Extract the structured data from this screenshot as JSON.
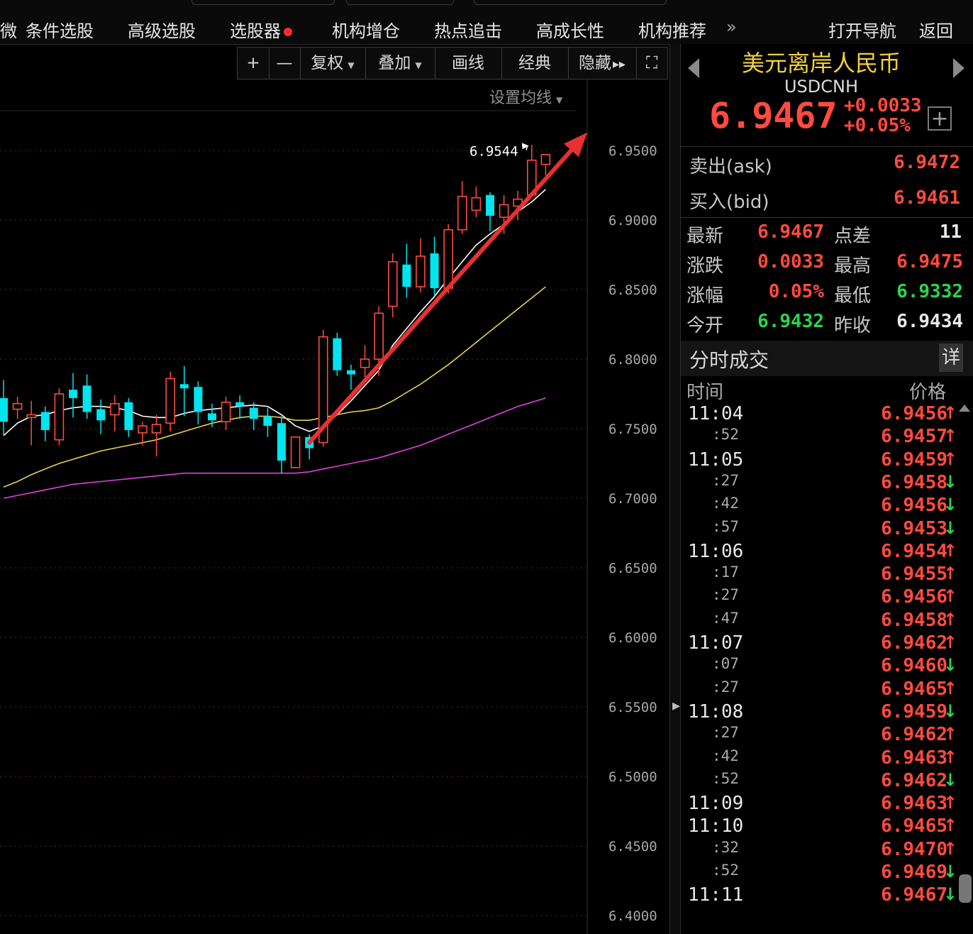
{
  "nav": {
    "partial_left": "微",
    "items": [
      "条件选股",
      "高级选股",
      "选股器",
      "机构增仓",
      "热点追击",
      "高成长性",
      "机构推荐"
    ],
    "more": "»",
    "open_nav": "打开导航",
    "back": "返回"
  },
  "toolbar": {
    "plus": "+",
    "minus": "—",
    "fuquan": "复权",
    "overlay": "叠加",
    "draw": "画线",
    "classic": "经典",
    "hide": "隐藏",
    "hide_arrow": "▸▸",
    "fullscreen": "⛶"
  },
  "chart": {
    "set_ma": "设置均线",
    "high_label": "6.9544",
    "y_ticks": [
      "6.9500",
      "6.9000",
      "6.8500",
      "6.8000",
      "6.7500",
      "6.7000",
      "6.6500",
      "6.6000",
      "6.5500",
      "6.5000",
      "6.4500",
      "6.4000"
    ]
  },
  "chart_data": {
    "type": "candlestick",
    "y_axis": {
      "min": 6.4,
      "max": 6.95,
      "ticks": [
        6.95,
        6.9,
        6.85,
        6.8,
        6.75,
        6.7,
        6.65,
        6.6,
        6.55,
        6.5,
        6.45,
        6.4
      ]
    },
    "annotation": {
      "text": "6.9544",
      "value": 6.9544
    },
    "candles": [
      {
        "o": 6.772,
        "c": 6.755,
        "h": 6.785,
        "l": 6.745
      },
      {
        "o": 6.764,
        "c": 6.768,
        "h": 6.773,
        "l": 6.757
      },
      {
        "o": 6.758,
        "c": 6.76,
        "h": 6.77,
        "l": 6.738
      },
      {
        "o": 6.762,
        "c": 6.749,
        "h": 6.766,
        "l": 6.741
      },
      {
        "o": 6.742,
        "c": 6.775,
        "h": 6.779,
        "l": 6.738
      },
      {
        "o": 6.778,
        "c": 6.772,
        "h": 6.79,
        "l": 6.758
      },
      {
        "o": 6.781,
        "c": 6.762,
        "h": 6.789,
        "l": 6.757
      },
      {
        "o": 6.764,
        "c": 6.756,
        "h": 6.771,
        "l": 6.746
      },
      {
        "o": 6.76,
        "c": 6.768,
        "h": 6.774,
        "l": 6.748
      },
      {
        "o": 6.769,
        "c": 6.749,
        "h": 6.772,
        "l": 6.744
      },
      {
        "o": 6.747,
        "c": 6.752,
        "h": 6.755,
        "l": 6.738
      },
      {
        "o": 6.747,
        "c": 6.753,
        "h": 6.76,
        "l": 6.73
      },
      {
        "o": 6.754,
        "c": 6.786,
        "h": 6.791,
        "l": 6.748
      },
      {
        "o": 6.782,
        "c": 6.779,
        "h": 6.795,
        "l": 6.759
      },
      {
        "o": 6.78,
        "c": 6.762,
        "h": 6.784,
        "l": 6.753
      },
      {
        "o": 6.761,
        "c": 6.756,
        "h": 6.768,
        "l": 6.751
      },
      {
        "o": 6.755,
        "c": 6.769,
        "h": 6.773,
        "l": 6.749
      },
      {
        "o": 6.769,
        "c": 6.766,
        "h": 6.774,
        "l": 6.757
      },
      {
        "o": 6.765,
        "c": 6.757,
        "h": 6.769,
        "l": 6.749
      },
      {
        "o": 6.759,
        "c": 6.752,
        "h": 6.765,
        "l": 6.744
      },
      {
        "o": 6.754,
        "c": 6.727,
        "h": 6.759,
        "l": 6.718
      },
      {
        "o": 6.722,
        "c": 6.744,
        "h": 6.744,
        "l": 6.722
      },
      {
        "o": 6.744,
        "c": 6.736,
        "h": 6.746,
        "l": 6.728
      },
      {
        "o": 6.74,
        "c": 6.816,
        "h": 6.821,
        "l": 6.737
      },
      {
        "o": 6.815,
        "c": 6.792,
        "h": 6.819,
        "l": 6.788
      },
      {
        "o": 6.792,
        "c": 6.789,
        "h": 6.796,
        "l": 6.778
      },
      {
        "o": 6.794,
        "c": 6.8,
        "h": 6.81,
        "l": 6.787
      },
      {
        "o": 6.8,
        "c": 6.833,
        "h": 6.838,
        "l": 6.788
      },
      {
        "o": 6.838,
        "c": 6.87,
        "h": 6.876,
        "l": 6.83
      },
      {
        "o": 6.868,
        "c": 6.852,
        "h": 6.883,
        "l": 6.844
      },
      {
        "o": 6.852,
        "c": 6.874,
        "h": 6.887,
        "l": 6.848
      },
      {
        "o": 6.876,
        "c": 6.851,
        "h": 6.888,
        "l": 6.846
      },
      {
        "o": 6.851,
        "c": 6.893,
        "h": 6.897,
        "l": 6.847
      },
      {
        "o": 6.893,
        "c": 6.917,
        "h": 6.928,
        "l": 6.89
      },
      {
        "o": 6.907,
        "c": 6.916,
        "h": 6.924,
        "l": 6.902
      },
      {
        "o": 6.918,
        "c": 6.903,
        "h": 6.92,
        "l": 6.892
      },
      {
        "o": 6.902,
        "c": 6.911,
        "h": 6.918,
        "l": 6.89
      },
      {
        "o": 6.91,
        "c": 6.915,
        "h": 6.921,
        "l": 6.9
      },
      {
        "o": 6.918,
        "c": 6.943,
        "h": 6.954,
        "l": 6.917
      },
      {
        "o": 6.94,
        "c": 6.947,
        "h": 6.947,
        "l": 6.932
      }
    ],
    "series": [
      {
        "name": "MA-white",
        "color": "#ffffff",
        "values": [
          6.745,
          6.754,
          6.759,
          6.76,
          6.763,
          6.765,
          6.766,
          6.766,
          6.765,
          6.763,
          6.759,
          6.758,
          6.758,
          6.761,
          6.763,
          6.764,
          6.765,
          6.766,
          6.767,
          6.766,
          6.76,
          6.752,
          6.748,
          6.752,
          6.76,
          6.77,
          6.781,
          6.792,
          6.81,
          6.822,
          6.834,
          6.845,
          6.858,
          6.87,
          6.882,
          6.89,
          6.897,
          6.906,
          6.913,
          6.922
        ]
      },
      {
        "name": "MA-yellow",
        "color": "#e8d050",
        "values": [
          6.708,
          6.712,
          6.717,
          6.721,
          6.725,
          6.728,
          6.731,
          6.734,
          6.736,
          6.738,
          6.74,
          6.742,
          6.745,
          6.748,
          6.751,
          6.754,
          6.756,
          6.758,
          6.759,
          6.759,
          6.758,
          6.756,
          6.756,
          6.758,
          6.76,
          6.762,
          6.763,
          6.765,
          6.77,
          6.776,
          6.782,
          6.789,
          6.796,
          6.804,
          6.812,
          6.82,
          6.828,
          6.836,
          6.844,
          6.852
        ]
      },
      {
        "name": "MA-magenta",
        "color": "#e040e0",
        "values": [
          6.7,
          6.702,
          6.704,
          6.706,
          6.708,
          6.71,
          6.711,
          6.712,
          6.713,
          6.714,
          6.715,
          6.716,
          6.717,
          6.718,
          6.718,
          6.718,
          6.718,
          6.718,
          6.718,
          6.718,
          6.718,
          6.718,
          6.719,
          6.721,
          6.723,
          6.725,
          6.727,
          6.729,
          6.732,
          6.735,
          6.738,
          6.742,
          6.746,
          6.75,
          6.754,
          6.758,
          6.762,
          6.766,
          6.769,
          6.772
        ]
      }
    ],
    "trend_arrow": {
      "from_index": 22,
      "from_value": 6.74,
      "to_index": 42,
      "to_value": 6.963,
      "color": "#e83030"
    }
  },
  "quote": {
    "name": "美元离岸人民币",
    "code": "USDCNH",
    "price": "6.9467",
    "change": "+0.0033",
    "change_pct": "+0.05%",
    "add": "+",
    "ask_label": "卖出(ask)",
    "ask": "6.9472",
    "bid_label": "买入(bid)",
    "bid": "6.9461",
    "latest_label": "最新",
    "latest": "6.9467",
    "spread_label": "点差",
    "spread": "11",
    "chg_label": "涨跌",
    "chg": "0.0033",
    "high_label": "最高",
    "high": "6.9475",
    "pct_label": "涨幅",
    "pct": "0.05%",
    "low_label": "最低",
    "low": "6.9332",
    "open_label": "今开",
    "open": "6.9432",
    "prev_label": "昨收",
    "prev": "6.9434"
  },
  "trades": {
    "title": "分时成交",
    "detail": "详",
    "col_time": "时间",
    "col_price": "价格",
    "rows": [
      {
        "time": "11:04",
        "price": "6.9456",
        "dir": "up"
      },
      {
        "time": ":52",
        "price": "6.9457",
        "dir": "up"
      },
      {
        "time": "11:05",
        "price": "6.9459",
        "dir": "up"
      },
      {
        "time": ":27",
        "price": "6.9458",
        "dir": "down"
      },
      {
        "time": ":42",
        "price": "6.9456",
        "dir": "down"
      },
      {
        "time": ":57",
        "price": "6.9453",
        "dir": "down"
      },
      {
        "time": "11:06",
        "price": "6.9454",
        "dir": "up"
      },
      {
        "time": ":17",
        "price": "6.9455",
        "dir": "up"
      },
      {
        "time": ":27",
        "price": "6.9456",
        "dir": "up"
      },
      {
        "time": ":47",
        "price": "6.9458",
        "dir": "up"
      },
      {
        "time": "11:07",
        "price": "6.9462",
        "dir": "up"
      },
      {
        "time": ":07",
        "price": "6.9460",
        "dir": "down"
      },
      {
        "time": ":27",
        "price": "6.9465",
        "dir": "up"
      },
      {
        "time": "11:08",
        "price": "6.9459",
        "dir": "down"
      },
      {
        "time": ":27",
        "price": "6.9462",
        "dir": "up"
      },
      {
        "time": ":42",
        "price": "6.9463",
        "dir": "up"
      },
      {
        "time": ":52",
        "price": "6.9462",
        "dir": "down"
      },
      {
        "time": "11:09",
        "price": "6.9463",
        "dir": "up"
      },
      {
        "time": "11:10",
        "price": "6.9465",
        "dir": "up"
      },
      {
        "time": ":32",
        "price": "6.9470",
        "dir": "up"
      },
      {
        "time": ":52",
        "price": "6.9469",
        "dir": "down"
      },
      {
        "time": "11:11",
        "price": "6.9467",
        "dir": "down"
      }
    ]
  },
  "colors": {
    "up": "#ff4b3e",
    "down": "#00e5ee",
    "down_arrow": "#2ad64a",
    "accent_name": "#f0d040"
  }
}
